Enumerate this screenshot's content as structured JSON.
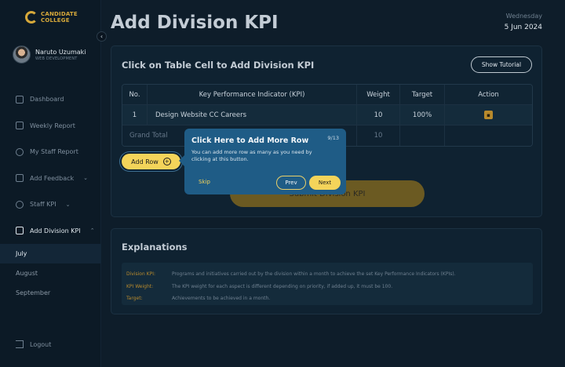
{
  "sidebar": {
    "logo_line1": "CANDIDATE",
    "logo_line2": "COLLEGE",
    "user_name": "Naruto Uzumaki",
    "user_role": "WEB DEVELOPMENT",
    "items": [
      {
        "label": "Dashboard",
        "icon": "grid-icon"
      },
      {
        "label": "Weekly Report",
        "icon": "calendar-icon"
      },
      {
        "label": "My Staff Report",
        "icon": "users-icon"
      },
      {
        "label": "Add Feedback",
        "icon": "plus-square-icon"
      },
      {
        "label": "Staff KPI",
        "icon": "user-icon"
      },
      {
        "label": "Add Division KPI",
        "icon": "document-icon"
      }
    ],
    "sub_items": [
      "July",
      "August",
      "September"
    ],
    "logout_label": "Logout"
  },
  "header": {
    "title": "Add Division KPI",
    "day": "Wednesday",
    "date": "5 Jun 2024"
  },
  "kpi_card": {
    "title": "Click on Table Cell to Add Division KPI",
    "tutorial_label": "Show Tutorial",
    "columns": [
      "No.",
      "Key Performance Indicator (KPI)",
      "Weight",
      "Target",
      "Action"
    ],
    "rows": [
      {
        "no": "1",
        "kpi": "Design Website CC Careers",
        "weight": "10",
        "target": "100%"
      }
    ],
    "total_label": "Grand Total",
    "total_weight": "10",
    "add_row_label": "Add Row",
    "submit_label": "Submit Division KPI"
  },
  "tooltip": {
    "title": "Click Here to Add More Row",
    "step": "9/13",
    "text": "You can add more row as many as you need by clicking at this button.",
    "skip_label": "Skip",
    "prev_label": "Prev",
    "next_label": "Next"
  },
  "explanations": {
    "title": "Explanations",
    "items": [
      {
        "term": "Division KPI:",
        "def": "Programs and initiatives carried out by the division within a month to achieve the set Key Performance Indicators (KPIs)."
      },
      {
        "term": "KPI Weight:",
        "def": "The KPI weight for each aspect is different depending on priority, if added up, it must be 100."
      },
      {
        "term": "Target:",
        "def": "Achievements to be achieved in a month."
      }
    ]
  },
  "colors": {
    "accent": "#f4d45a",
    "background": "#0e1d2a",
    "tooltip": "#1f5c86"
  }
}
